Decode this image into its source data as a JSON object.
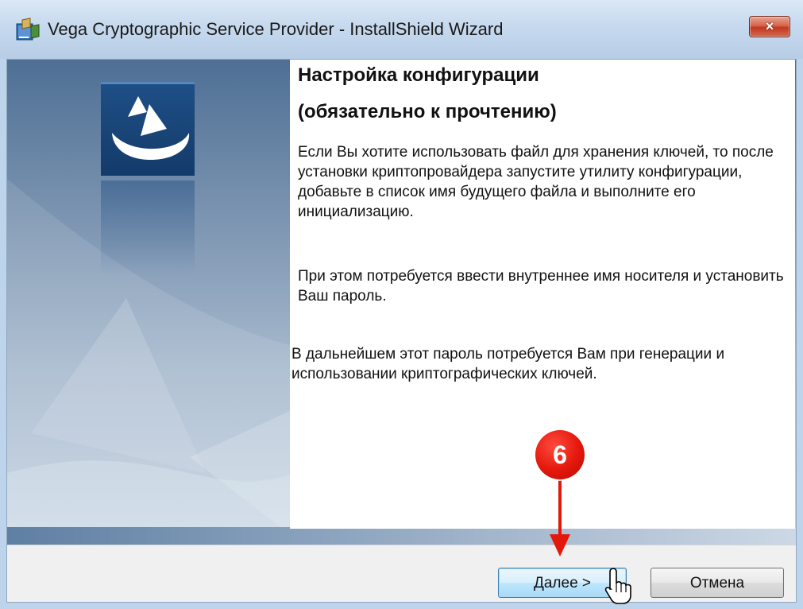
{
  "window": {
    "title": "Vega Cryptographic Service Provider - InstallShield Wizard",
    "close_label": "×"
  },
  "content": {
    "heading_line1": "Настройка конфигурации",
    "heading_line2": "(обязательно к прочтению)",
    "paragraph1": "Если Вы хотите использовать файл для хранения ключей, то после установки криптопровайдера запустите утилиту конфигурации, добавьте в список имя будущего файла и выполните его инициализацию.",
    "paragraph2": "При этом потребуется ввести внутреннее имя носителя и установить Ваш пароль.",
    "paragraph3": "В дальнейшем этот пароль потребуется Вам при генерации и использовании криптографических ключей."
  },
  "buttons": {
    "next_label": "Далее >",
    "cancel_label": "Отмена"
  },
  "annotation": {
    "step_number": "6"
  },
  "icons": {
    "title_icon": "installer-icon",
    "logo": "vega-logo-icon",
    "cursor": "hand-pointer-icon",
    "arrow": "arrow-down-icon"
  },
  "colors": {
    "annotation_red": "#e4170c",
    "close_red": "#c2381f",
    "logo_blue": "#1e4f86"
  }
}
